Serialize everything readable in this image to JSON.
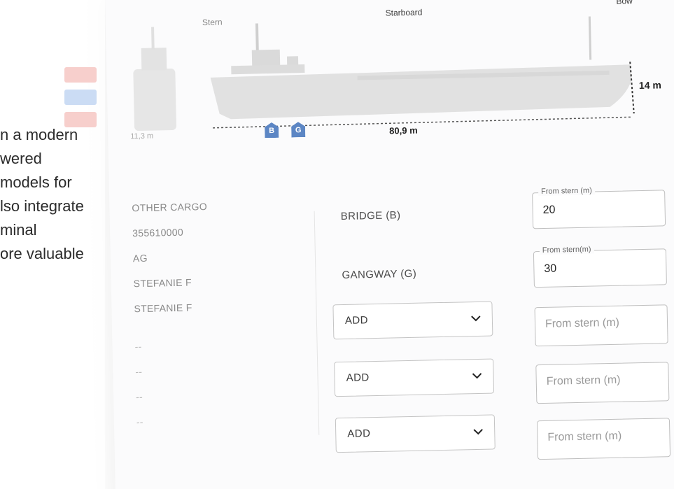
{
  "ship_view": {
    "labels": {
      "stern": "Stern",
      "starboard": "Starboard",
      "bow": "Bow"
    },
    "length": "80,9 m",
    "height": "14 m",
    "beam": "11,3 m",
    "markers": [
      "B",
      "G"
    ]
  },
  "vessel_info": {
    "values": [
      "OTHER CARGO",
      "355610000",
      "AG",
      "STEFANIE F",
      "STEFANIE F",
      "--",
      "--",
      "--",
      "--"
    ]
  },
  "positions": {
    "bridge": {
      "label": "BRIDGE (B)",
      "field_label": "From stern (m)",
      "value": "20"
    },
    "gangway": {
      "label": "GANGWAY (G)",
      "field_label": "From stern(m)",
      "value": "30"
    },
    "add_rows": [
      {
        "select": "ADD",
        "placeholder": "From stern (m)"
      },
      {
        "select": "ADD",
        "placeholder": "From stern (m)"
      },
      {
        "select": "ADD",
        "placeholder": "From stern (m)"
      }
    ]
  },
  "promo_text": [
    "n a modern",
    "wered",
    "models for",
    "lso integrate",
    "minal",
    "ore valuable"
  ],
  "colors": {
    "marker": "#5c86c4",
    "ghost_red": "#f0a7a2",
    "ghost_blue": "#a9c4ec",
    "hull": "#e0e0e0"
  }
}
